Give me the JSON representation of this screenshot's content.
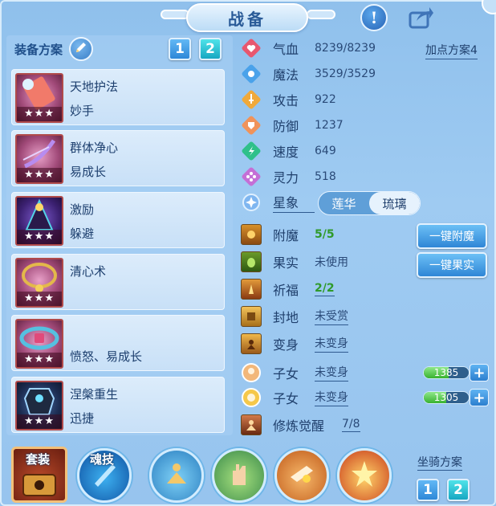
{
  "header": {
    "title": "战备",
    "info_icon": "info-icon",
    "share_icon": "share-icon"
  },
  "equipment": {
    "scheme_label": "装备方案",
    "scheme_buttons": [
      "1",
      "2"
    ],
    "active_scheme": "2",
    "items": [
      {
        "line1": "天地护法",
        "line2": "妙手",
        "stars": "★★★",
        "icon": "scroll-item-icon"
      },
      {
        "line1": "群体净心",
        "line2": "易成长",
        "stars": "★★★",
        "icon": "bow-item-icon"
      },
      {
        "line1": "激励",
        "line2": "躲避",
        "stars": "★★★",
        "icon": "cloak-item-icon"
      },
      {
        "line1": "清心术",
        "line2": "",
        "stars": "★★★",
        "icon": "necklace-item-icon"
      },
      {
        "line1": "",
        "line2": "愤怒、易成长",
        "stars": "★★★",
        "icon": "belt-item-icon"
      },
      {
        "line1": "涅槃重生",
        "line2": "迅捷",
        "stars": "★★★",
        "icon": "armor-item-icon"
      }
    ]
  },
  "stats": {
    "add_scheme": "加点方案4",
    "rows": [
      {
        "label": "气血",
        "value": "8239/8239",
        "icon": "heart-icon",
        "color": "#e8576f"
      },
      {
        "label": "魔法",
        "value": "3529/3529",
        "icon": "mana-icon",
        "color": "#4aa2ea"
      },
      {
        "label": "攻击",
        "value": "922",
        "icon": "sword-icon",
        "color": "#f0a93a"
      },
      {
        "label": "防御",
        "value": "1237",
        "icon": "shield-icon",
        "color": "#f0935a"
      },
      {
        "label": "速度",
        "value": "649",
        "icon": "speed-icon",
        "color": "#2fc08a"
      },
      {
        "label": "灵力",
        "value": "518",
        "icon": "spirit-icon",
        "color": "#c46fd6"
      }
    ],
    "star_label": "星象",
    "star_options": [
      "莲华",
      "琉璃"
    ],
    "star_selected": "琉璃"
  },
  "extras": {
    "rows": [
      {
        "label": "附魔",
        "value": "5/5",
        "style": "green",
        "icon": "enchant-icon"
      },
      {
        "label": "果实",
        "value": "未使用",
        "style": "plain",
        "icon": "fruit-icon"
      },
      {
        "label": "祈福",
        "value": "2/2",
        "style": "green-underline",
        "icon": "pray-icon"
      },
      {
        "label": "封地",
        "value": "未受赏",
        "style": "underline",
        "icon": "fief-icon"
      },
      {
        "label": "变身",
        "value": "未变身",
        "style": "underline",
        "icon": "transform-icon"
      }
    ],
    "one_click_enchant": "一键附魔",
    "one_click_fruit": "一键果实"
  },
  "children": [
    {
      "label": "子女",
      "value": "未变身",
      "bar_value": "1385",
      "icon": "child-girl-icon",
      "fill_fraction": 0.55
    },
    {
      "label": "子女",
      "value": "未变身",
      "bar_value": "1305",
      "icon": "child-boy-icon",
      "fill_fraction": 0.5
    }
  ],
  "cultivation": {
    "label": "修炼觉醒",
    "value": "7/8",
    "icon": "cultivation-icon"
  },
  "bottom": {
    "suit_label": "套装",
    "soul_skill_label": "魂技",
    "mount_label": "坐骑方案",
    "mount_buttons": [
      "1",
      "2"
    ],
    "active_mount": "2"
  }
}
